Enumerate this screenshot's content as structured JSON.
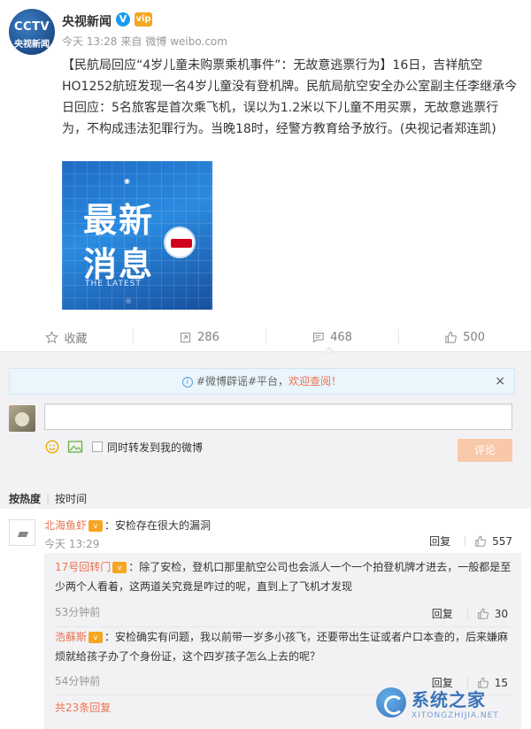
{
  "post": {
    "avatar_logo": "CCTV",
    "avatar_name": "央视新闻",
    "author": "央视新闻",
    "verified_mark": "V",
    "vip_mark": "vip",
    "time": "今天 13:28",
    "source_prefix": "来自",
    "source": "微博 weibo.com",
    "text": "【民航局回应“4岁儿童未购票乘机事件”：无故意逃票行为】16日，吉祥航空HO1252航班发现一名4岁儿童没有登机牌。民航局航空安全办公室副主任李继承今日回应：5名旅客是首次乘飞机，误以为1.2米以下儿童不用买票，无故意逃票行为，不构成违法犯罪行为。当晚18时，经警方教育给予放行。(央视记者郑连凯)",
    "image": {
      "line1": "最新",
      "line2": "消息",
      "subtitle": "THE LATEST"
    }
  },
  "actions": {
    "favorite_label": "收藏",
    "repost_count": "286",
    "comment_count": "468",
    "like_count": "500"
  },
  "notice": {
    "prefix": "#微博辟谣#平台，",
    "link": "欢迎查阅！",
    "close": "×"
  },
  "composer": {
    "placeholder": "",
    "repost_label": "同时转发到我的微博",
    "submit_label": "评论"
  },
  "sort": {
    "by_hot": "按热度",
    "by_time": "按时间"
  },
  "comments": [
    {
      "user": "北海鱼虾",
      "text": "：安检存在很大的漏洞",
      "time": "今天 13:29",
      "reply": "回复",
      "likes": "557"
    }
  ],
  "replies": [
    {
      "user": "17号回转门",
      "text": "：除了安检，登机口那里航空公司也会派人一个一个拍登机牌才进去，一般都是至少两个人看着，这两道关究竟是咋过的呢，直到上了飞机才发现",
      "time": "53分钟前",
      "reply": "回复",
      "likes": "30"
    },
    {
      "user": "浩蘇斯",
      "text": "：安检确实有问题，我以前带一岁多小孩飞，还要带出生证或者户口本查的，后来嫌麻烦就给孩子办了个身份证，这个四岁孩子怎么上去的呢？",
      "time": "54分钟前",
      "reply": "回复",
      "likes": "15"
    }
  ],
  "more_replies": "共23条回复",
  "watermark": {
    "name": "系统之家",
    "url": "XITONGZHIJIA.NET"
  },
  "colors": {
    "link": "#eb7350",
    "submit": "#f9c8a9",
    "notice_bg": "#eaf5fc"
  }
}
